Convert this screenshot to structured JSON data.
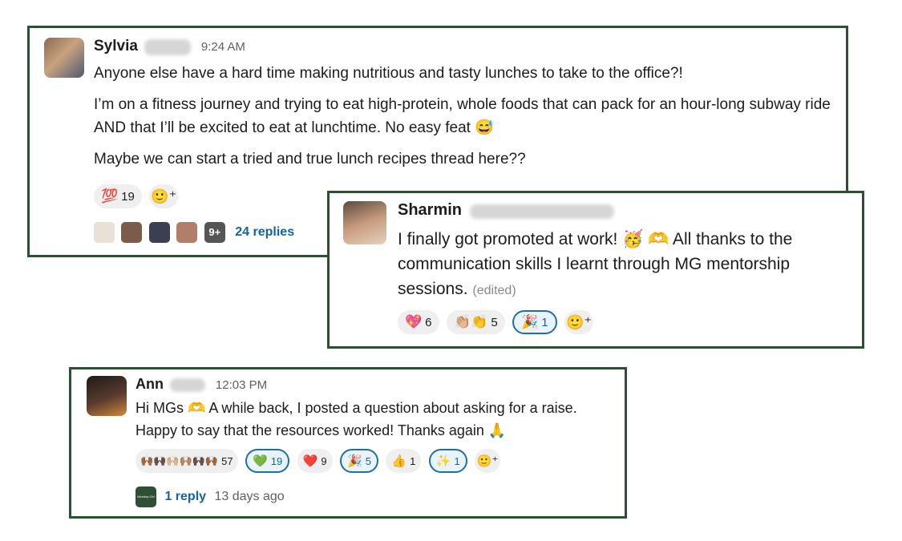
{
  "messages": [
    {
      "author": "Sylvia",
      "time": "9:24 AM",
      "paragraphs": [
        "Anyone else have a hard time making nutritious and tasty lunches to take to the office?!",
        "I’m on a fitness journey and trying to eat high-protein, whole foods that can pack for an hour-long subway ride AND that I’ll be excited to eat at lunchtime. No easy feat 😅",
        "Maybe we can start a tried and true lunch recipes thread here??"
      ],
      "reactions": [
        {
          "emoji": "💯",
          "count": "19"
        }
      ],
      "thread": {
        "more": "9+",
        "replies": "24 replies"
      }
    },
    {
      "author": "Sharmin",
      "text": "I finally got promoted at work! 🥳 🫶 All thanks to the communication skills I learnt through MG mentorship sessions.",
      "edited": "(edited)",
      "reactions": [
        {
          "emoji": "💖",
          "count": "6"
        },
        {
          "emoji": "👏🏼👏",
          "count": "5"
        },
        {
          "emoji": "🎉",
          "count": "1"
        }
      ]
    },
    {
      "author": "Ann",
      "time": "12:03 PM",
      "text": "Hi MGs 🫶  A while back, I posted a question about asking for a raise. Happy to say that the resources worked! Thanks again 🙏",
      "reactions": [
        {
          "emoji": "🙌🏾🙌🏿🙌🏼🙌🏽🙌🏿🙌🏾",
          "count": "57"
        },
        {
          "emoji": "💚",
          "count": "19"
        },
        {
          "emoji": "❤️",
          "count": "9"
        },
        {
          "emoji": "🎉",
          "count": "5"
        },
        {
          "emoji": "👍",
          "count": "1"
        },
        {
          "emoji": "✨",
          "count": "1"
        }
      ],
      "thread": {
        "avatar_text": "Monday Girl",
        "replies": "1 reply",
        "last": "13 days ago"
      }
    }
  ],
  "icons": {
    "add_reaction": "🙂⁺"
  }
}
